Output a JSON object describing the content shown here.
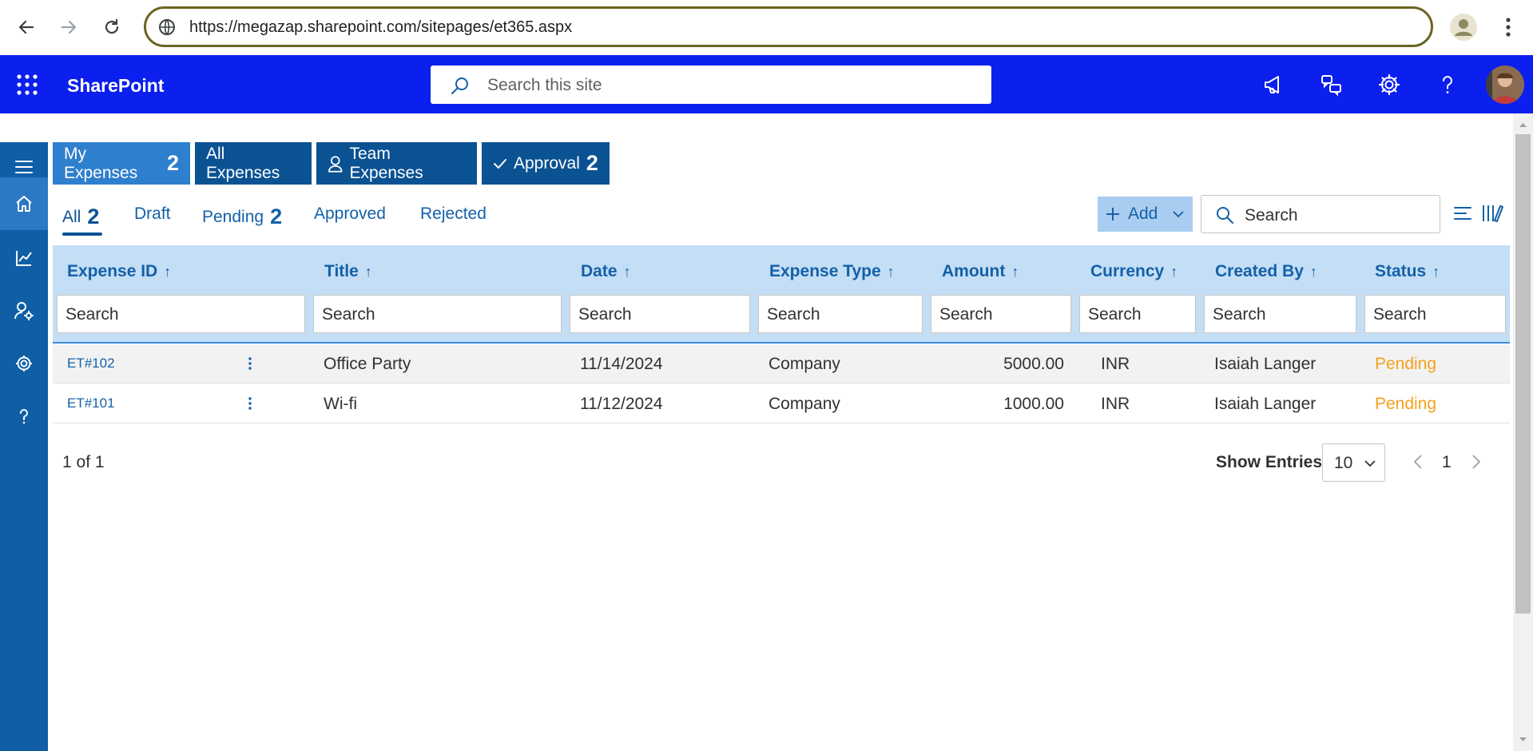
{
  "browser": {
    "url": "https://megazap.sharepoint.com/sitepages/et365.aspx"
  },
  "suite": {
    "brand": "SharePoint",
    "search_placeholder": "Search this site"
  },
  "top_tabs": [
    {
      "label": "My Expenses",
      "count": "2"
    },
    {
      "label": "All Expenses",
      "count": ""
    },
    {
      "label": "Team Expenses",
      "count": ""
    },
    {
      "label": "Approval",
      "count": "2"
    }
  ],
  "filters": [
    {
      "label": "All",
      "count": "2"
    },
    {
      "label": "Draft",
      "count": ""
    },
    {
      "label": "Pending",
      "count": "2"
    },
    {
      "label": "Approved",
      "count": ""
    },
    {
      "label": "Rejected",
      "count": ""
    }
  ],
  "toolbar": {
    "add_label": "Add",
    "search_placeholder": "Search"
  },
  "columns": [
    {
      "label": "Expense ID",
      "arrow": "↑",
      "filter": "Search"
    },
    {
      "label": "Title",
      "arrow": "↑",
      "filter": "Search"
    },
    {
      "label": "Date",
      "arrow": "↑",
      "filter": "Search"
    },
    {
      "label": "Expense Type",
      "arrow": "↑",
      "filter": "Search"
    },
    {
      "label": "Amount",
      "arrow": "↑",
      "filter": "Search"
    },
    {
      "label": "Currency",
      "arrow": "↑",
      "filter": "Search"
    },
    {
      "label": "Created By",
      "arrow": "↑",
      "filter": "Search"
    },
    {
      "label": "Status",
      "arrow": "↑",
      "filter": "Search"
    }
  ],
  "rows": [
    {
      "id": "ET#102",
      "title": "Office Party",
      "date": "11/14/2024",
      "type": "Company",
      "amount": "5000.00",
      "currency": "INR",
      "created_by": "Isaiah Langer",
      "status": "Pending"
    },
    {
      "id": "ET#101",
      "title": "Wi-fi",
      "date": "11/12/2024",
      "type": "Company",
      "amount": "1000.00",
      "currency": "INR",
      "created_by": "Isaiah Langer",
      "status": "Pending"
    }
  ],
  "footer": {
    "page_info": "1 of 1",
    "show_entries_label": "Show Entries",
    "entries_value": "10",
    "current_page": "1"
  },
  "colors": {
    "suite_bar": "#0b1fee",
    "rail": "#0f5ea6",
    "accent": "#1460a8",
    "status_pending": "#f4a21c"
  }
}
